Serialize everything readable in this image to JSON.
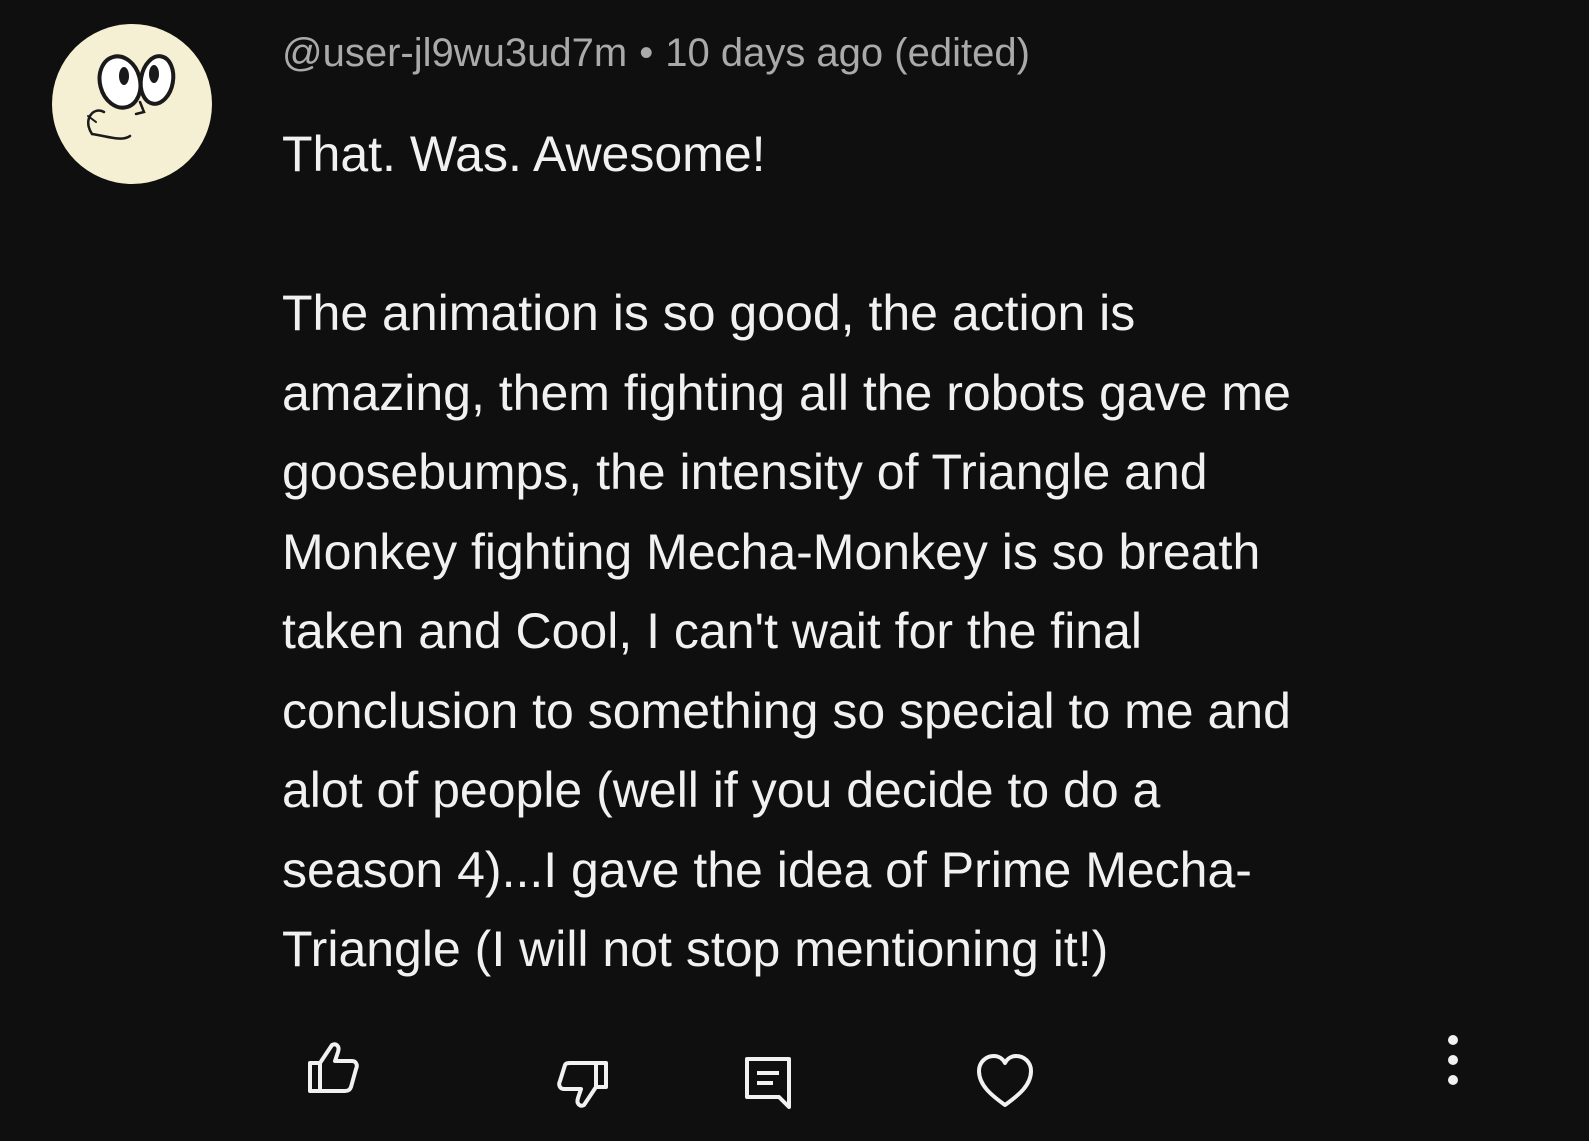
{
  "comment": {
    "author": "@user-jl9wu3ud7m",
    "separator": "•",
    "timestamp": "10 days ago (edited)",
    "lines": [
      "That. Was. Awesome!",
      "",
      "The animation is so good, the action is",
      "amazing, them fighting all the robots gave me",
      "goosebumps, the intensity of Triangle and",
      "Monkey fighting Mecha-Monkey is so breath",
      "taken and Cool, I can't wait for the final",
      "conclusion to something so special to me and",
      "alot of people (well if you decide to do a",
      "season 4)...I gave the idea of Prime Mecha-",
      "Triangle (I will not stop mentioning it!)"
    ]
  },
  "actions": {
    "icons": [
      "thumbs-up-icon",
      "thumbs-down-icon",
      "reply-icon",
      "heart-icon",
      "more-vertical-icon"
    ]
  },
  "colors": {
    "background": "#0f0f0f",
    "text": "#f1f1f1",
    "meta": "#aaaaaa",
    "avatar_bg": "#f5efd3"
  }
}
